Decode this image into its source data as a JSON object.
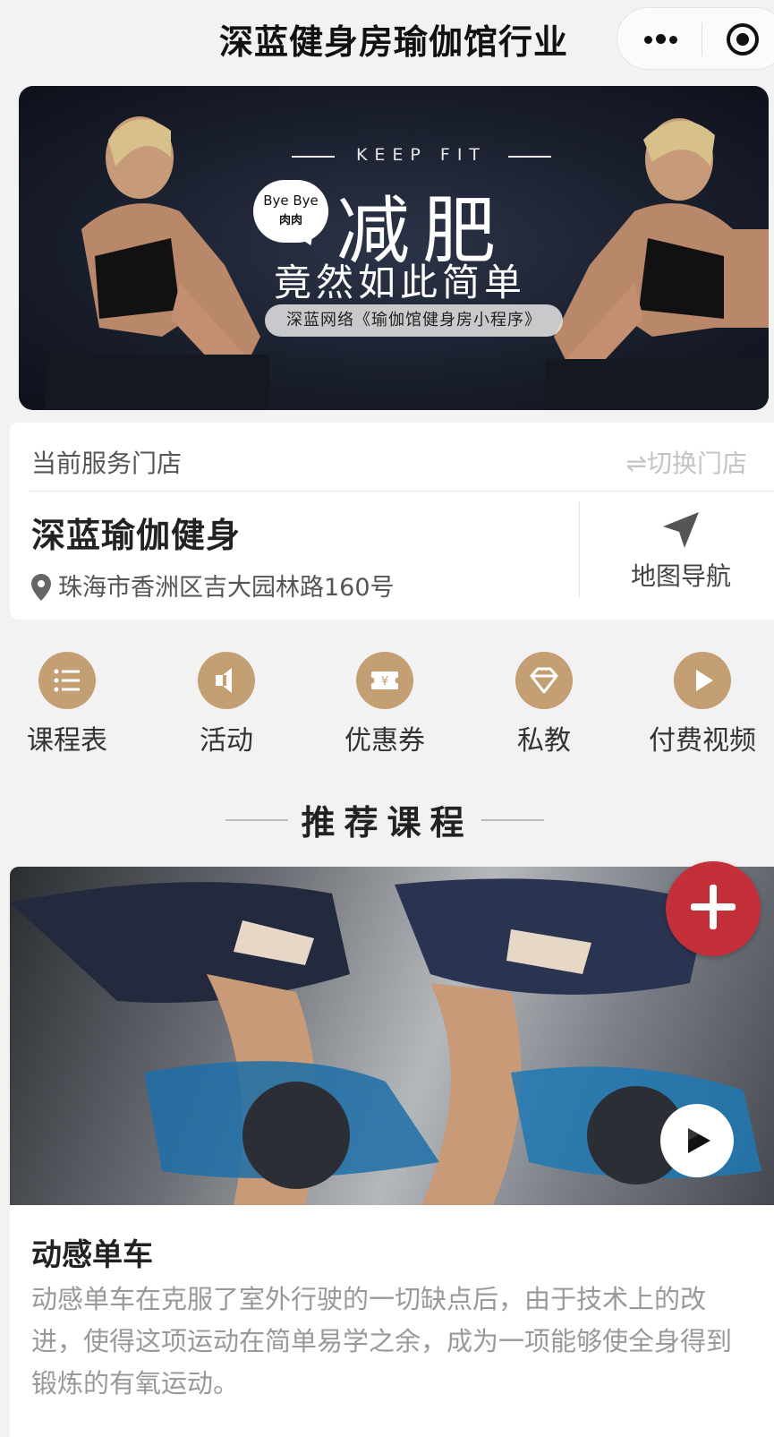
{
  "app": {
    "title": "深蓝健身房瑜伽馆行业"
  },
  "banner": {
    "tagline": "KEEP FIT",
    "bubble_line1": "Bye Bye",
    "bubble_line2": "肉肉",
    "headline": "减肥",
    "subheadline": "竟然如此简单",
    "pill": "深蓝网络《瑜伽馆健身房小程序》"
  },
  "store": {
    "header_label": "当前服务门店",
    "switch_label": "⇌切换门店",
    "name": "深蓝瑜伽健身",
    "address": "珠海市香洲区吉大园林路160号",
    "nav_label": "地图导航"
  },
  "menu": {
    "items": [
      {
        "label": "课程表",
        "icon": "list-icon"
      },
      {
        "label": "活动",
        "icon": "speaker-icon"
      },
      {
        "label": "优惠券",
        "icon": "coupon-icon"
      },
      {
        "label": "私教",
        "icon": "diamond-icon"
      },
      {
        "label": "付费视频",
        "icon": "play-icon"
      }
    ],
    "accent": "#c59f74"
  },
  "section": {
    "title": "推荐课程"
  },
  "course": {
    "title": "动感单车",
    "description": "动感单车在克服了室外行驶的一切缺点后，由于技术上的改进，使得这项运动在简单易学之余，成为一项能够使全身得到锻炼的有氧运动。"
  },
  "fab": {
    "icon": "plus-icon",
    "color": "#c4303a"
  }
}
